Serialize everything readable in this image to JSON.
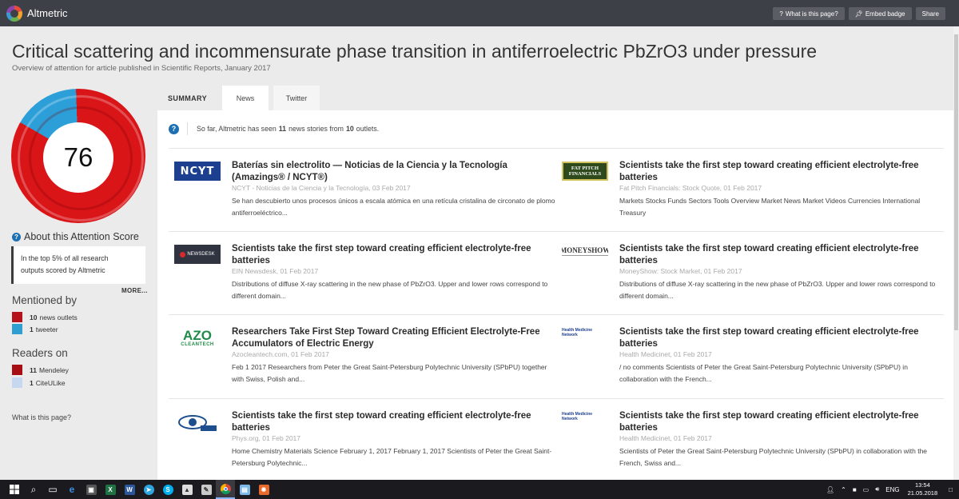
{
  "app": {
    "name": "Altmetric"
  },
  "toolbar": {
    "what_label": "What is this page?",
    "embed_label": "Embed badge",
    "share_label": "Share"
  },
  "article": {
    "title": "Critical scattering and incommensurate phase transition in antiferroelectric PbZrO3 under pressure",
    "subtitle": "Overview of attention for article published in Scientific Reports, January 2017"
  },
  "score": {
    "value": "76",
    "about_title": "About this Attention Score",
    "about_line1": "In the top 5% of all research",
    "about_line2": "outputs scored by Altmetric",
    "more": "MORE...",
    "colors": {
      "news": "#d91518",
      "twitter": "#2c9fd9"
    }
  },
  "mentioned": {
    "title": "Mentioned by",
    "items": [
      {
        "count": "10",
        "label": "news outlets",
        "color": "#b5121b"
      },
      {
        "count": "1",
        "label": "tweeter",
        "color": "#2e9fd0"
      }
    ]
  },
  "readers": {
    "title": "Readers on",
    "items": [
      {
        "count": "11",
        "label": "Mendeley",
        "color": "#a60e14"
      },
      {
        "count": "1",
        "label": "CiteULike",
        "color": "#c6d8f0"
      }
    ]
  },
  "what_page": "What is this page?",
  "tabs": [
    "SUMMARY",
    "News",
    "Twitter"
  ],
  "notice": {
    "prefix": "So far, Altmetric has seen",
    "stories": "11",
    "middle": "news stories from",
    "outlets": "10",
    "suffix": "outlets."
  },
  "news": [
    {
      "logo": "NCYT",
      "title": "Baterías sin electrolito — Noticias de la Ciencia y la Tecnología (Amazings® / NCYT®)",
      "meta": "NCYT - Noticias de la Ciencia y la Tecnología, 03 Feb 2017",
      "text": "Se han descubierto unos procesos únicos a escala atómica en una retícula cristalina de circonato de plomo antiferroeléctrico..."
    },
    {
      "logo": "FAT PITCH FINANCIALS",
      "title": "Scientists take the first step toward creating efficient electrolyte-free batteries",
      "meta": "Fat Pitch Financials: Stock Quote, 01 Feb 2017",
      "text": "Markets Stocks Funds Sectors Tools Overview Market News Market Videos Currencies International Treasury"
    },
    {
      "logo": "NEWSDESK",
      "title": "Scientists take the first step toward creating efficient electrolyte-free batteries",
      "meta": "EIN Newsdesk, 01 Feb 2017",
      "text": "Distributions of diffuse X-ray scattering in the new phase of PbZrO3. Upper and lower rows correspond to different domain..."
    },
    {
      "logo": "MONEYSHOW",
      "title": "Scientists take the first step toward creating efficient electrolyte-free batteries",
      "meta": "MoneyShow: Stock Market, 01 Feb 2017",
      "text": "Distributions of diffuse X-ray scattering in the new phase of PbZrO3. Upper and lower rows correspond to different domain..."
    },
    {
      "logo": "AZO CLEANTECH",
      "title": "Researchers Take First Step Toward Creating Efficient Electrolyte-Free Accumulators of Electric Energy",
      "meta": "Azocleantech.com, 01 Feb 2017",
      "text": "Feb 1 2017 Researchers from Peter the Great Saint-Petersburg Polytechnic University (SPbPU) together with Swiss, Polish and..."
    },
    {
      "logo": "Health Medicine Network",
      "title": "Scientists take the first step toward creating efficient electrolyte-free batteries",
      "meta": "Health Medicinet, 01 Feb 2017",
      "text": "/ no comments Scientists of Peter the Great Saint-Petersburg Polytechnic University (SPbPU) in collaboration with the French..."
    },
    {
      "logo": "PHYS",
      "title": "Scientists take the first step toward creating efficient electrolyte-free batteries",
      "meta": "Phys.org, 01 Feb 2017",
      "text": "Home Chemistry Materials Science February 1, 2017 February 1, 2017 Scientists of Peter the Great Saint-Petersburg Polytechnic..."
    },
    {
      "logo": "Health Medicine Network",
      "title": "Scientists take the first step toward creating efficient electrolyte-free batteries",
      "meta": "Health Medicinet, 01 Feb 2017",
      "text": "Scientists of Peter the Great Saint-Petersburg Polytechnic University (SPbPU) in collaboration with the French, Swiss and..."
    }
  ],
  "taskbar": {
    "lang": "ENG",
    "time": "13:54",
    "date": "21.05.2018",
    "icons": [
      "windows-icon",
      "search-icon",
      "task-view-icon",
      "edge-icon",
      "store-icon",
      "excel-icon",
      "word-icon",
      "telegram-icon",
      "skype-icon",
      "photos-icon",
      "paint-icon",
      "chrome-icon",
      "files-icon",
      "fire-icon"
    ]
  }
}
